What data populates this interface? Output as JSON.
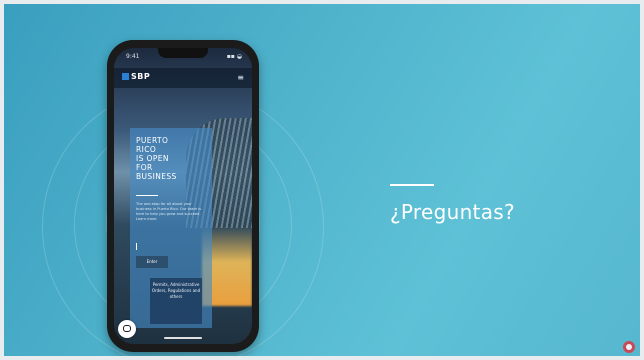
{
  "phone": {
    "status_time": "9:41",
    "status_signal": "▪▪ ◒",
    "brand": "SBP",
    "hero_headline": "PUERTO\nRICO\nIS OPEN\nFOR\nBUSINESS",
    "hero_description": "The one-stop for all about your business in Puerto Rico. Our team is here to help you grow and succeed. Learn more",
    "cta_label": "Enter",
    "info_box": "Permits, Administrative Orders, Regulations and others"
  },
  "slide": {
    "question": "¿Preguntas?"
  },
  "colors": {
    "background_teal": "#4fb3cc",
    "panel_blue": "#468cc8"
  },
  "icons": {
    "menu": "hamburger-menu-icon",
    "chat": "chat-bubble-icon",
    "logo": "brand-logo-icon"
  }
}
